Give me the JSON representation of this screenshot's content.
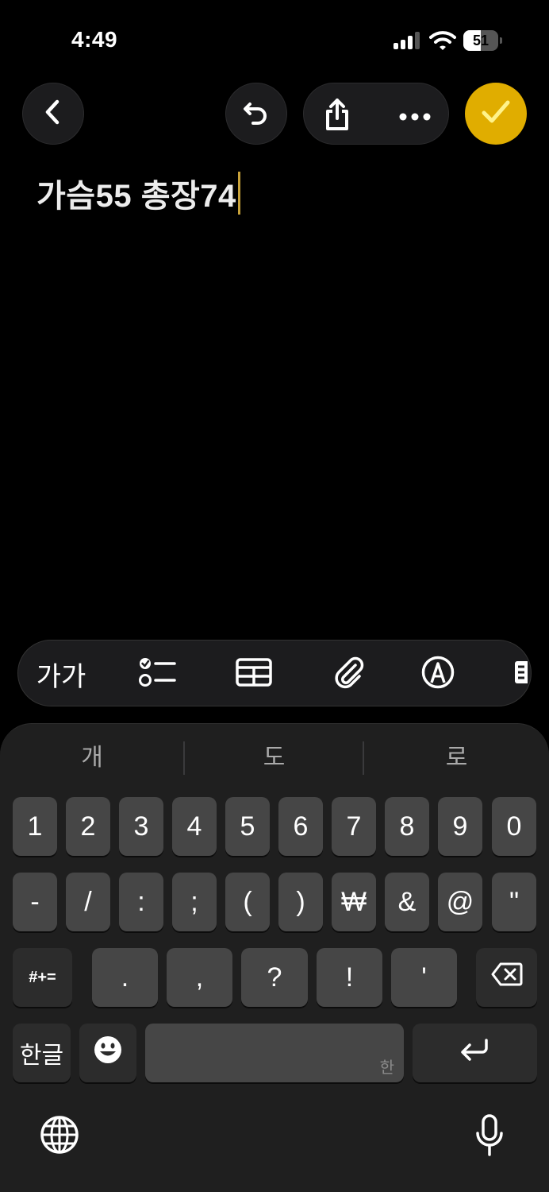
{
  "status_bar": {
    "time": "4:49",
    "battery_percent": "51",
    "battery_level": 0.51,
    "signal_bars_active": 3
  },
  "toolbar": {
    "back_icon": "chevron-left-icon",
    "undo_icon": "undo-icon",
    "share_icon": "share-icon",
    "more_icon": "ellipsis-icon",
    "done_icon": "checkmark-icon",
    "accent_color": "#e0ad00"
  },
  "note": {
    "text": "가슴55 총장74",
    "cursor_color": "#c8a23a"
  },
  "format_bar": {
    "text_style_label": "가가",
    "icons": [
      "checklist-icon",
      "table-icon",
      "paperclip-icon",
      "markup-icon",
      "more-format-icon"
    ]
  },
  "keyboard": {
    "suggestions": [
      "개",
      "도",
      "로"
    ],
    "row1": [
      "1",
      "2",
      "3",
      "4",
      "5",
      "6",
      "7",
      "8",
      "9",
      "0"
    ],
    "row2": [
      "-",
      "/",
      ":",
      ";",
      "(",
      ")",
      "₩",
      "&",
      "@",
      "\""
    ],
    "row3_symbols_label": "#+=",
    "row3": [
      ".",
      ",",
      "?",
      "!",
      "'"
    ],
    "backspace_icon": "backspace-icon",
    "language_label": "한글",
    "emoji_icon": "emoji-icon",
    "space_sub_label": "한",
    "return_icon": "return-icon",
    "globe_icon": "globe-icon",
    "mic_icon": "microphone-icon"
  }
}
